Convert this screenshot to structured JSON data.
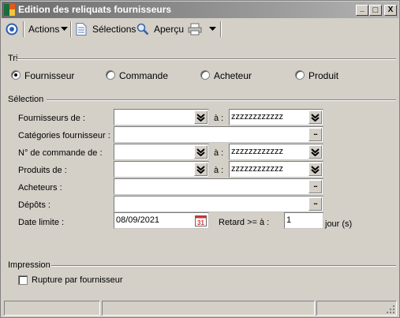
{
  "window": {
    "title": "Edition des reliquats fournisseurs",
    "controls": {
      "minimize": "_",
      "maximize": "□",
      "close": "X"
    }
  },
  "toolbar": {
    "nav_icon": "circle-nav-icon",
    "actions_label": "Actions",
    "selections_label": "Sélections",
    "apercu_label": "Aperçu",
    "print_icon": "printer-icon"
  },
  "tri": {
    "title": "Tri",
    "options": [
      {
        "label": "Fournisseur",
        "selected": true
      },
      {
        "label": "Commande",
        "selected": false
      },
      {
        "label": "Acheteur",
        "selected": false
      },
      {
        "label": "Produit",
        "selected": false
      }
    ]
  },
  "selection": {
    "title": "Sélection",
    "separator": "à :",
    "fournisseurs": {
      "label": "Fournisseurs de :",
      "from": "",
      "to": "zzzzzzzzzzzz"
    },
    "categories": {
      "label": "Catégories fournisseur :",
      "value": ""
    },
    "commande": {
      "label": "N° de commande de :",
      "from": "",
      "to": "zzzzzzzzzzzz"
    },
    "produits": {
      "label": "Produits de :",
      "from": "",
      "to": "zzzzzzzzzzzz"
    },
    "acheteurs": {
      "label": "Acheteurs :",
      "value": ""
    },
    "depots": {
      "label": "Dépôts :",
      "value": ""
    },
    "date_limite": {
      "label": "Date limite :",
      "value": "08/09/2021",
      "calendar_day": "31"
    },
    "retard": {
      "label": "Retard >= à :",
      "value": "1",
      "unit": "jour (s)"
    }
  },
  "impression": {
    "title": "Impression",
    "rupture": {
      "label": "Rupture par fournisseur",
      "checked": false
    }
  },
  "colors": {
    "titlebar_start": "#6c6c6c",
    "titlebar_end": "#b4b4b4",
    "face": "#d4d0c8"
  }
}
